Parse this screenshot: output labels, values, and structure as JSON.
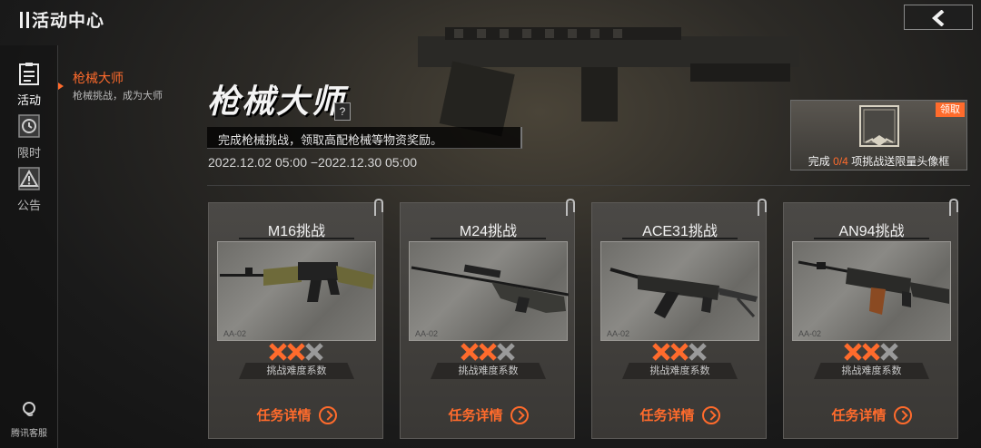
{
  "app": {
    "title": "活动中心"
  },
  "sidebar": {
    "items": [
      {
        "label": "活动",
        "icon": "clipboard-icon",
        "active": true
      },
      {
        "label": "限时",
        "icon": "clock-icon",
        "active": false
      },
      {
        "label": "公告",
        "icon": "warning-icon",
        "active": false
      }
    ],
    "service_label": "腾讯客服"
  },
  "submenu": {
    "title": "枪械大师",
    "subtitle": "枪械挑战，成为大师"
  },
  "event": {
    "title": "枪械大师",
    "help": "?",
    "description": "完成枪械挑战，领取高配枪械等物资奖励。",
    "dates": "2022.12.02 05:00 −2022.12.30 05:00"
  },
  "reward": {
    "claim_label": "领取",
    "prefix": "完成",
    "progress": "0/4",
    "suffix": "项挑战送限量头像框"
  },
  "cards": [
    {
      "name": "M16挑战",
      "tag": "AA-02",
      "difficulty_label": "挑战难度系数",
      "difficulty": 2,
      "difficulty_max": 3,
      "detail_label": "任务详情"
    },
    {
      "name": "M24挑战",
      "tag": "AA-02",
      "difficulty_label": "挑战难度系数",
      "difficulty": 2,
      "difficulty_max": 3,
      "detail_label": "任务详情"
    },
    {
      "name": "ACE31挑战",
      "tag": "AA-02",
      "difficulty_label": "挑战难度系数",
      "difficulty": 2,
      "difficulty_max": 3,
      "detail_label": "任务详情"
    },
    {
      "name": "AN94挑战",
      "tag": "AA-02",
      "difficulty_label": "挑战难度系数",
      "difficulty": 2,
      "difficulty_max": 3,
      "detail_label": "任务详情"
    }
  ],
  "colors": {
    "accent": "#ff6b2c",
    "star_inactive": "#9a9a9a"
  }
}
